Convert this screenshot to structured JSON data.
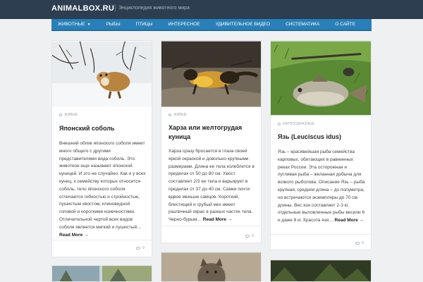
{
  "site": {
    "brand": "ANIMALBOX.RU",
    "separator": "|",
    "tagline": "Энциклопедия животного мира"
  },
  "nav": [
    {
      "label": "Животные",
      "has_dropdown": true
    },
    {
      "label": "Рыбы"
    },
    {
      "label": "Птицы"
    },
    {
      "label": "Интересное"
    },
    {
      "label": "Удивительное видео"
    },
    {
      "label": "Систематика"
    },
    {
      "label": "О сайте"
    }
  ],
  "posts": [
    {
      "category": "Живые",
      "title": "Японский соболь",
      "excerpt": "Внешний облик японского соболя имеет много общего с другими представителями вида соболь. Это животное еще называют японской куницей. И это не случайно. Как и у всех куниц, к семейству которых относится соболь, тело японского соболя отличается гибкостью и стройностью, пушистым хвостом, клиновидной головой и короткими конечностями. Отличительной чертой всех видов соболя является мягкий и пушистый…",
      "read_more": "Read More →",
      "comments": "0"
    },
    {
      "category": "Живые",
      "title": "Харза или желтогрудая куница",
      "excerpt": "Харза сразу бросается в глаза своей яркой окраской и довольно крупными размерами. Длина ее тела колеблется в пределах от 50 до 80 см. Хвост составляет 2/3 ее тела и варьирует в пределах от 37 до 40 см. Самки почти вдвое меньше самцов. Короткий, блестящий и грубый мех имеет различный окрас в разных частях тела. Черно-бурым…",
      "read_more": "Read More →",
      "comments": "0"
    },
    {
      "category": "Карпообразные",
      "title": "Язь (Leuciscus idus)",
      "excerpt": "Язь – красивейшая рыба семейства карповых, обитающих в равнинных реках России. Эта осторожная и пугливая рыба – желанная добыча для всякого рыболова. Описание Язь – рыба крупная, средняя длина – до полуметра, но встречаются экземпляры до 70 см длины. Вес язя составляет 2-3 кг, отдельные выловленные рыбы весили 6 и даже 8 кг. Красота язя…",
      "read_more": "Read More →",
      "comments": "0"
    }
  ]
}
